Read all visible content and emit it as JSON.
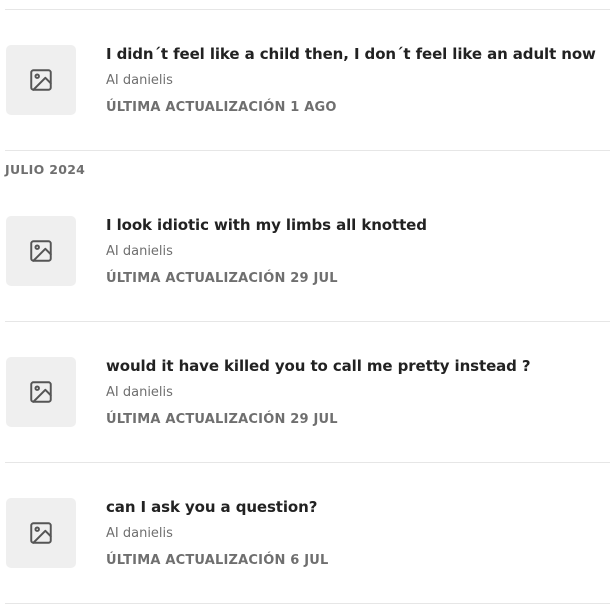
{
  "sections": [
    {
      "heading": "",
      "stories": [
        {
          "title": "I didn´t feel like a child then, I don´t feel like an adult now",
          "author": "AI danielis",
          "updated": "ÚLTIMA ACTUALIZACIÓN 1 AGO",
          "thumbnail_icon": "image-placeholder-icon"
        }
      ]
    },
    {
      "heading": "JULIO 2024",
      "stories": [
        {
          "title": "I look idiotic with my limbs all knotted",
          "author": "AI danielis",
          "updated": "ÚLTIMA ACTUALIZACIÓN 29 JUL",
          "thumbnail_icon": "image-placeholder-icon"
        },
        {
          "title": "would it have killed you to call me pretty instead ?",
          "author": "AI danielis",
          "updated": "ÚLTIMA ACTUALIZACIÓN 29 JUL",
          "thumbnail_icon": "image-placeholder-icon"
        },
        {
          "title": "can I ask you a question?",
          "author": "AI danielis",
          "updated": "ÚLTIMA ACTUALIZACIÓN 6 JUL",
          "thumbnail_icon": "image-placeholder-icon"
        }
      ]
    }
  ],
  "colors": {
    "title": "#222222",
    "secondary_text": "#6f6f6f",
    "thumbnail_bg": "#efefef",
    "divider": "#e6e6e6"
  }
}
